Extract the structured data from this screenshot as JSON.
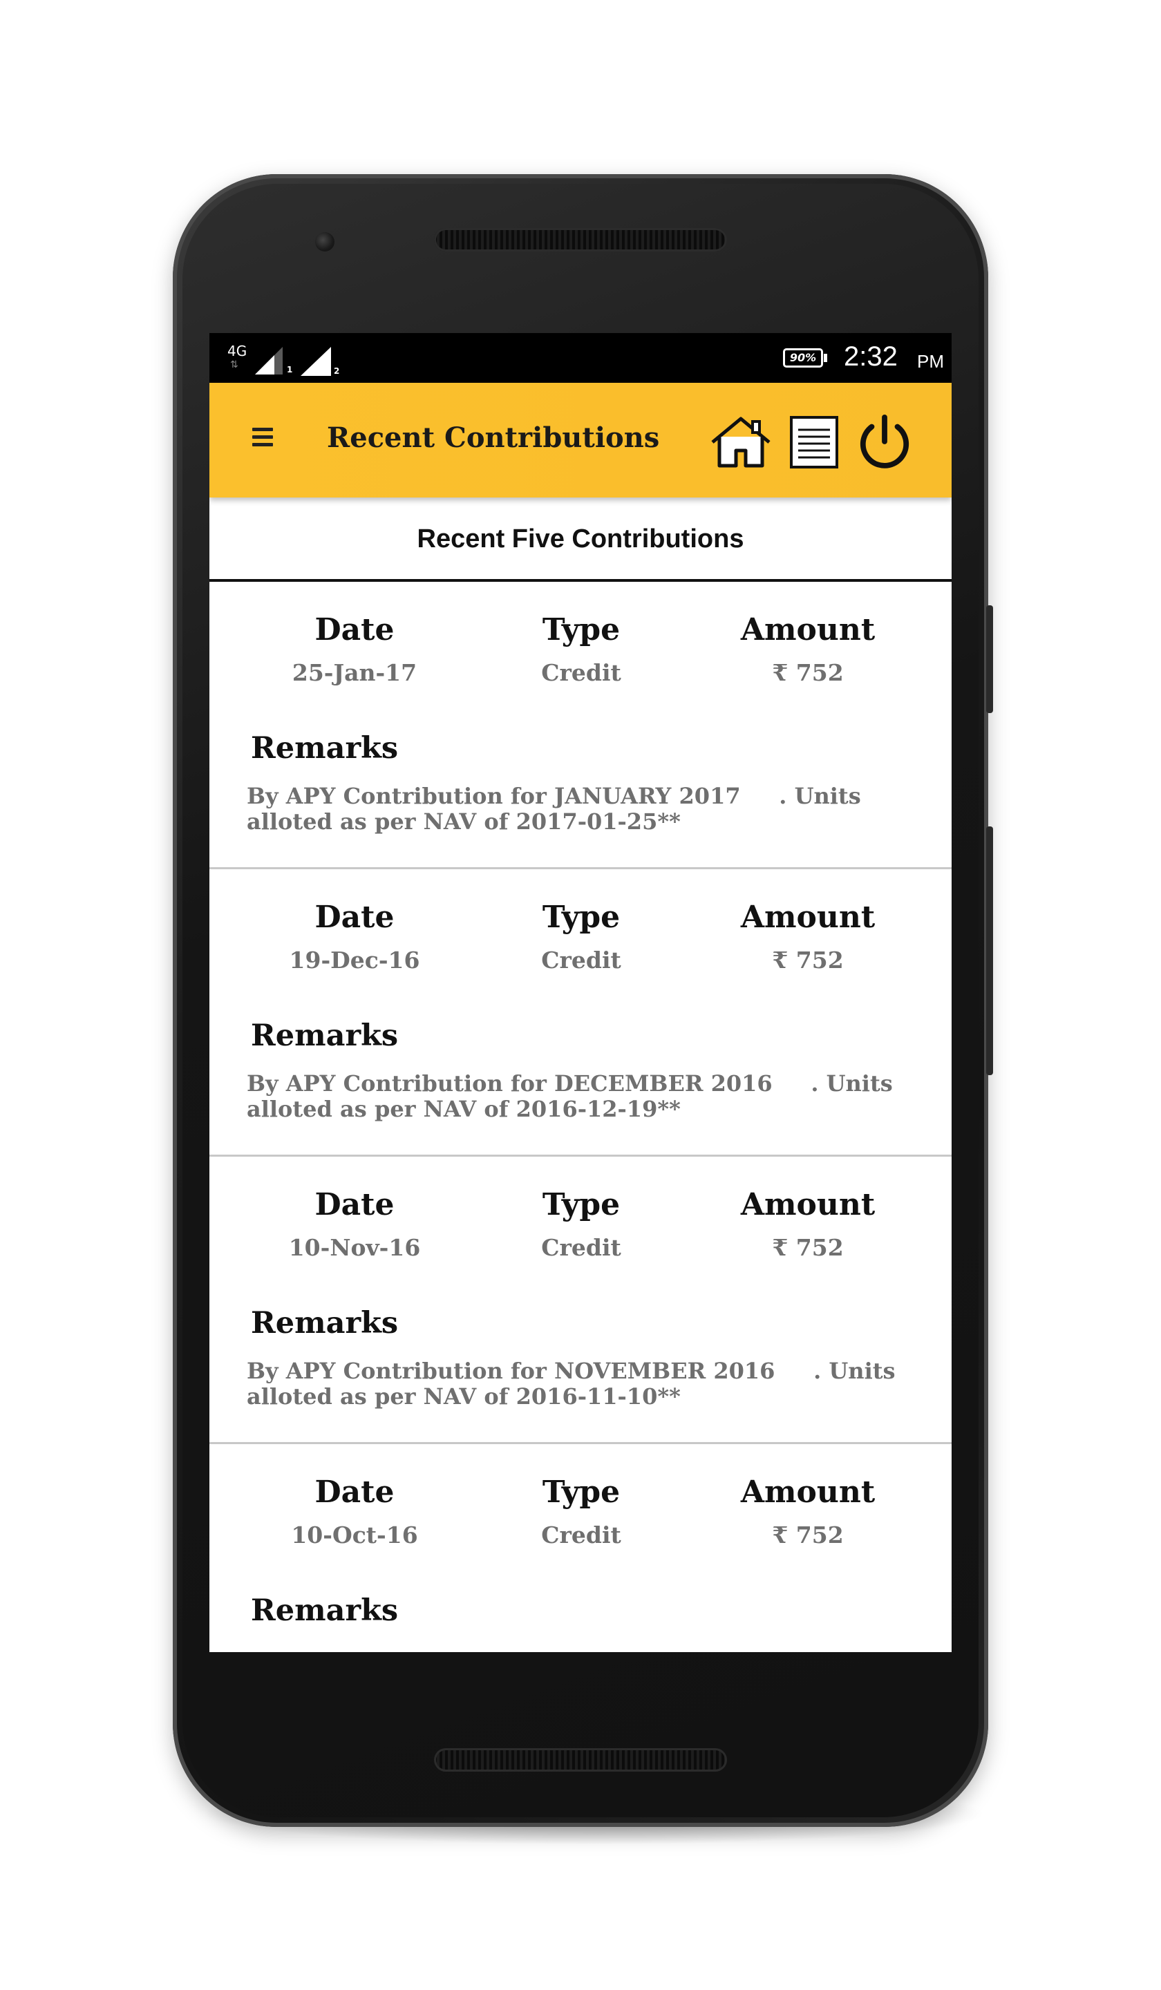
{
  "status_bar": {
    "network": "4G",
    "sim1": "1",
    "sim2": "2",
    "battery": "90%",
    "time": "2:32",
    "ampm": "PM"
  },
  "app_bar": {
    "title": "Recent Contributions",
    "icons": [
      "menu-icon",
      "home-icon",
      "document-icon",
      "power-icon"
    ]
  },
  "section": {
    "title": "Recent Five Contributions"
  },
  "labels": {
    "date": "Date",
    "type": "Type",
    "amount": "Amount",
    "remarks": "Remarks"
  },
  "contributions": [
    {
      "date": "25-Jan-17",
      "type": "Credit",
      "amount": "₹ 752",
      "remarks": "By APY Contribution for JANUARY 2017     . Units alloted as per NAV of 2017-01-25**"
    },
    {
      "date": "19-Dec-16",
      "type": "Credit",
      "amount": "₹ 752",
      "remarks": "By APY Contribution for DECEMBER 2016     . Units alloted as per NAV of 2016-12-19**"
    },
    {
      "date": "10-Nov-16",
      "type": "Credit",
      "amount": "₹ 752",
      "remarks": "By APY Contribution for NOVEMBER 2016     . Units alloted as per NAV of 2016-11-10**"
    },
    {
      "date": "10-Oct-16",
      "type": "Credit",
      "amount": "₹ 752",
      "remarks": ""
    }
  ],
  "colors": {
    "app_bar": "#fbc02d",
    "status_bar": "#000000",
    "value_text": "#6f6f6f"
  }
}
